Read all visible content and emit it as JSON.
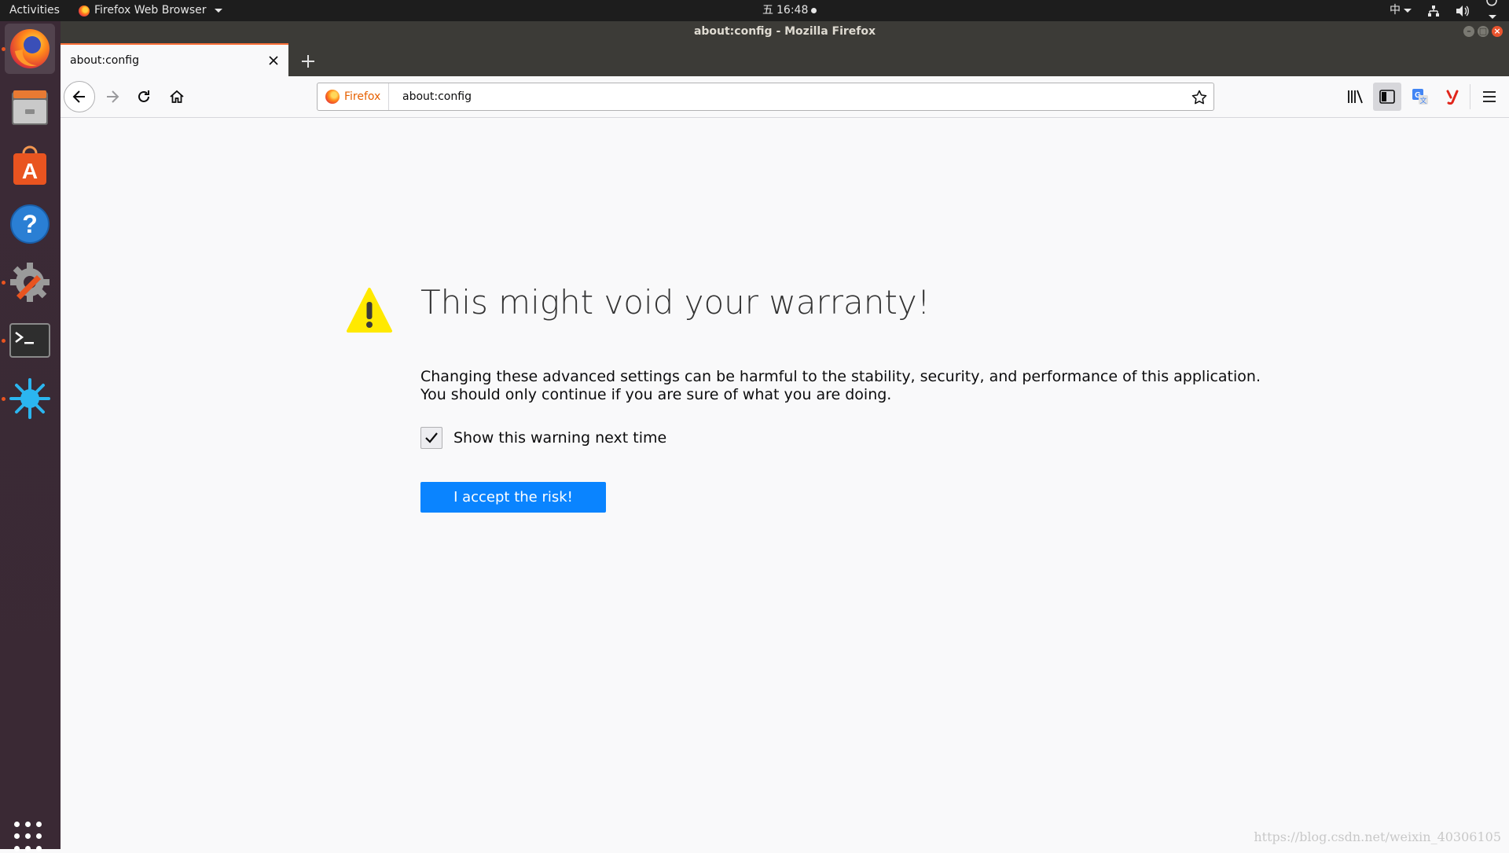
{
  "topbar": {
    "activities": "Activities",
    "app_menu": "Firefox Web Browser",
    "clock_day": "五",
    "clock_time": "16:48",
    "input_method": "中"
  },
  "dock": {
    "items": [
      {
        "name": "Firefox",
        "icon": "firefox-icon",
        "running": true,
        "active": true
      },
      {
        "name": "Files",
        "icon": "files-icon",
        "running": false
      },
      {
        "name": "Ubuntu Software",
        "icon": "software-icon",
        "running": false
      },
      {
        "name": "Help",
        "icon": "help-icon",
        "running": false
      },
      {
        "name": "System Settings",
        "icon": "settings-icon",
        "running": true
      },
      {
        "name": "Terminal",
        "icon": "terminal-icon",
        "running": true
      },
      {
        "name": "Application",
        "icon": "star-burst-icon",
        "running": true
      }
    ]
  },
  "window": {
    "title": "about:config - Mozilla Firefox"
  },
  "tab": {
    "title": "about:config"
  },
  "urlbar": {
    "identity_label": "Firefox",
    "value": "about:config"
  },
  "warning": {
    "title": "This might void your warranty!",
    "desc_line1": "Changing these advanced settings can be harmful to the stability, security, and performance of this application.",
    "desc_line2": "You should only continue if you are sure of what you are doing.",
    "checkbox_label": "Show this warning next time",
    "checkbox_checked": true,
    "accept_button": "I accept the risk!"
  },
  "watermark": "https://blog.csdn.net/weixin_40306105",
  "colors": {
    "accent_blue": "#0a84ff",
    "tab_highlight": "#ff7139",
    "warning_yellow": "#ffe900"
  }
}
